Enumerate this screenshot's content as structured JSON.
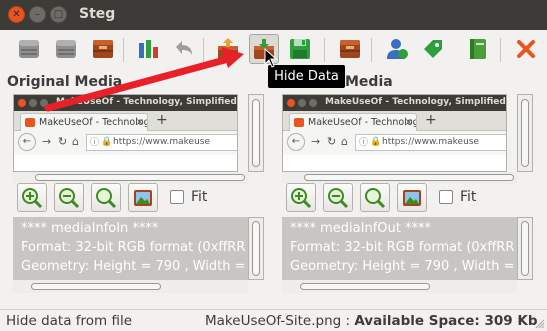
{
  "window": {
    "title": "Steg"
  },
  "toolbar": {
    "buttons": [
      {
        "name": "open-original-button",
        "icon": "disk-gray-icon"
      },
      {
        "name": "save-original-button",
        "icon": "disk-gray-icon"
      },
      {
        "name": "media-button",
        "icon": "book-icon"
      },
      {
        "name": "statistics-button",
        "icon": "bar-chart-icon"
      },
      {
        "name": "undo-button",
        "icon": "undo-icon"
      },
      {
        "name": "extract-data-button",
        "icon": "box-out-icon"
      },
      {
        "name": "hide-data-button",
        "icon": "box-in-icon"
      },
      {
        "name": "save-button",
        "icon": "floppy-icon"
      },
      {
        "name": "passphrase-button",
        "icon": "book-icon"
      },
      {
        "name": "user-button",
        "icon": "user-icon"
      },
      {
        "name": "tag-button",
        "icon": "tag-icon"
      },
      {
        "name": "notebook-button",
        "icon": "notebook-icon"
      },
      {
        "name": "exit-button",
        "icon": "close-x-icon"
      }
    ],
    "tooltip": "Hide Data"
  },
  "original_pane": {
    "title": "Original Media",
    "info_lines": [
      "**** mediaInfoIn ****",
      "Format: 32-bit RGB format (0xffRR",
      "Geometry: Height = 790 , Width ="
    ]
  },
  "modified_pane": {
    "title": "Media",
    "info_lines": [
      "**** mediaInfOut ****",
      "Format: 32-bit RGB format (0xffRR",
      "Geometry: Height = 790 , Width ="
    ]
  },
  "preview": {
    "window_title": "MakeUseOf - Technology, Simplified - Mozilla Firefox",
    "tab_label": "MakeUseOf - Technolog",
    "url": "https://www.makeuse"
  },
  "zoom": {
    "fit_label": "Fit",
    "fit_checked": false
  },
  "status": {
    "left": "Hide data from file",
    "file": "MakeUseOf-Site.png : ",
    "space": "Available Space: 309 Kb"
  },
  "colors": {
    "accent": "#e95420",
    "titlebar": "#3c3b37",
    "arrow": "#e8202a"
  }
}
